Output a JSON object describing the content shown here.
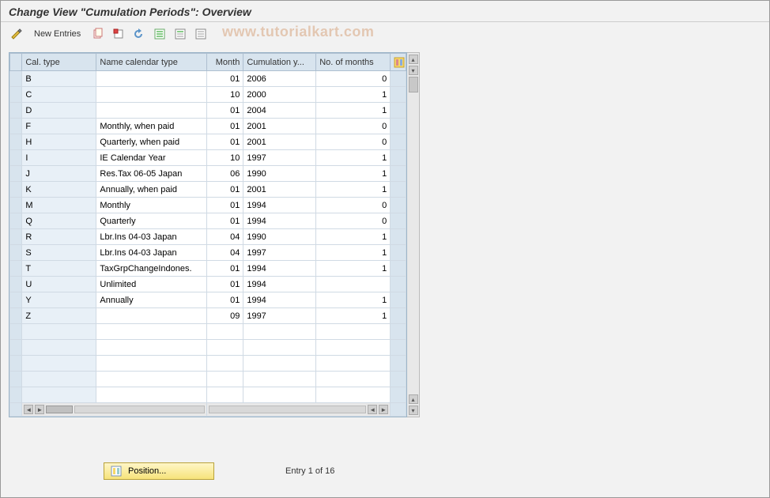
{
  "title": "Change View \"Cumulation Periods\": Overview",
  "toolbar": {
    "new_entries": "New Entries"
  },
  "watermark": "www.tutorialkart.com",
  "columns": {
    "cal_type": "Cal. type",
    "name": "Name calendar type",
    "month": "Month",
    "cum_year": "Cumulation y...",
    "months": "No. of months"
  },
  "rows": [
    {
      "cal": "B",
      "name": "",
      "month": "01",
      "year": "2006",
      "months": "0"
    },
    {
      "cal": "C",
      "name": "",
      "month": "10",
      "year": "2000",
      "months": "1"
    },
    {
      "cal": "D",
      "name": "",
      "month": "01",
      "year": "2004",
      "months": "1"
    },
    {
      "cal": "F",
      "name": "Monthly, when paid",
      "month": "01",
      "year": "2001",
      "months": "0"
    },
    {
      "cal": "H",
      "name": "Quarterly, when paid",
      "month": "01",
      "year": "2001",
      "months": "0"
    },
    {
      "cal": "I",
      "name": "IE Calendar Year",
      "month": "10",
      "year": "1997",
      "months": "1"
    },
    {
      "cal": "J",
      "name": "Res.Tax 06-05  Japan",
      "month": "06",
      "year": "1990",
      "months": "1"
    },
    {
      "cal": "K",
      "name": "Annually, when paid",
      "month": "01",
      "year": "2001",
      "months": "1"
    },
    {
      "cal": "M",
      "name": "Monthly",
      "month": "01",
      "year": "1994",
      "months": "0"
    },
    {
      "cal": "Q",
      "name": "Quarterly",
      "month": "01",
      "year": "1994",
      "months": "0"
    },
    {
      "cal": "R",
      "name": "Lbr.Ins 04-03  Japan",
      "month": "04",
      "year": "1990",
      "months": "1"
    },
    {
      "cal": "S",
      "name": "Lbr.Ins 04-03  Japan",
      "month": "04",
      "year": "1997",
      "months": "1"
    },
    {
      "cal": "T",
      "name": "TaxGrpChangeIndones.",
      "month": "01",
      "year": "1994",
      "months": "1"
    },
    {
      "cal": "U",
      "name": "Unlimited",
      "month": "01",
      "year": "1994",
      "months": ""
    },
    {
      "cal": "Y",
      "name": "Annually",
      "month": "01",
      "year": "1994",
      "months": "1"
    },
    {
      "cal": "Z",
      "name": "",
      "month": "09",
      "year": "1997",
      "months": "1"
    }
  ],
  "empty_rows": 5,
  "footer": {
    "position_btn": "Position...",
    "entry_status": "Entry 1 of 16"
  }
}
